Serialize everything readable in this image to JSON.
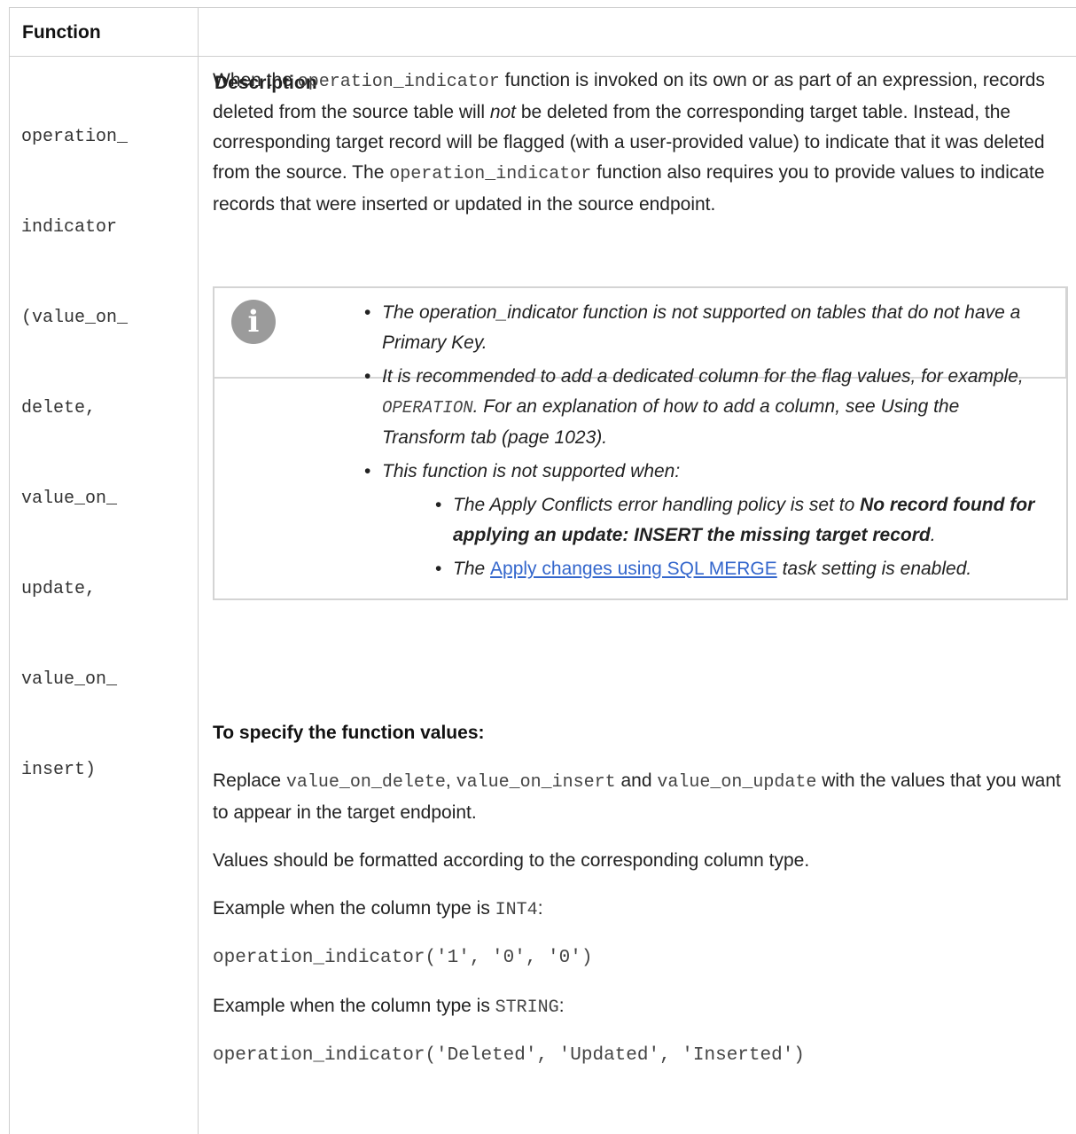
{
  "table": {
    "header": {
      "function": "Function",
      "description": "Description"
    },
    "function_cell": [
      "operation_",
      "indicator",
      "(value_on_",
      "delete,",
      "value_on_",
      "update,",
      "value_on_",
      "insert)"
    ],
    "para1": {
      "a": "When the ",
      "code1": "operation_indicator",
      "b": " function is invoked on its own or as part of an expression, records deleted from the source table will ",
      "not": "not",
      "c": " be deleted from the corresponding target table. Instead, the corresponding target record will be flagged (with a user-provided value) to indicate that it was deleted from the source. The ",
      "code2": "operation_indicator",
      "d": " function also requires you to provide values to indicate records that were inserted or updated in the source endpoint."
    },
    "note": {
      "icon": "info-icon",
      "b1": "The operation_indicator function is not supported on tables that do not have a Primary Key.",
      "b2a": "It is recommended to add a dedicated column for the flag values, for example, ",
      "b2code": "OPERATION",
      "b2b": ". For an explanation of how to add a column, see Using the Transform tab (page 1023).",
      "b3": "This function is not supported when:",
      "s1a": "The Apply Conflicts error handling policy is set to ",
      "s1bold": "No record found for applying an update: INSERT the missing target record",
      "s1end": ".",
      "s2a": "The ",
      "s2link": "Apply changes using SQL MERGE",
      "s2b": " task setting is enabled."
    },
    "specify_heading": "To specify the function values:",
    "replace": {
      "a": "Replace ",
      "c1": "value_on_delete",
      "b": ", ",
      "c2": "value_on_insert",
      "c": " and ",
      "c3": "value_on_update",
      "d": " with the values that you want to appear in the target endpoint."
    },
    "values_text": "Values should be formatted according to the corresponding column type.",
    "example1": {
      "a": "Example when the column type is ",
      "code": "INT4",
      "b": ":"
    },
    "example1_code": "operation_indicator('1', '0', '0')",
    "example2": {
      "a": "Example when the column type is ",
      "code": "STRING",
      "b": ":"
    },
    "example2_code": "operation_indicator('Deleted', 'Updated', 'Inserted')"
  }
}
